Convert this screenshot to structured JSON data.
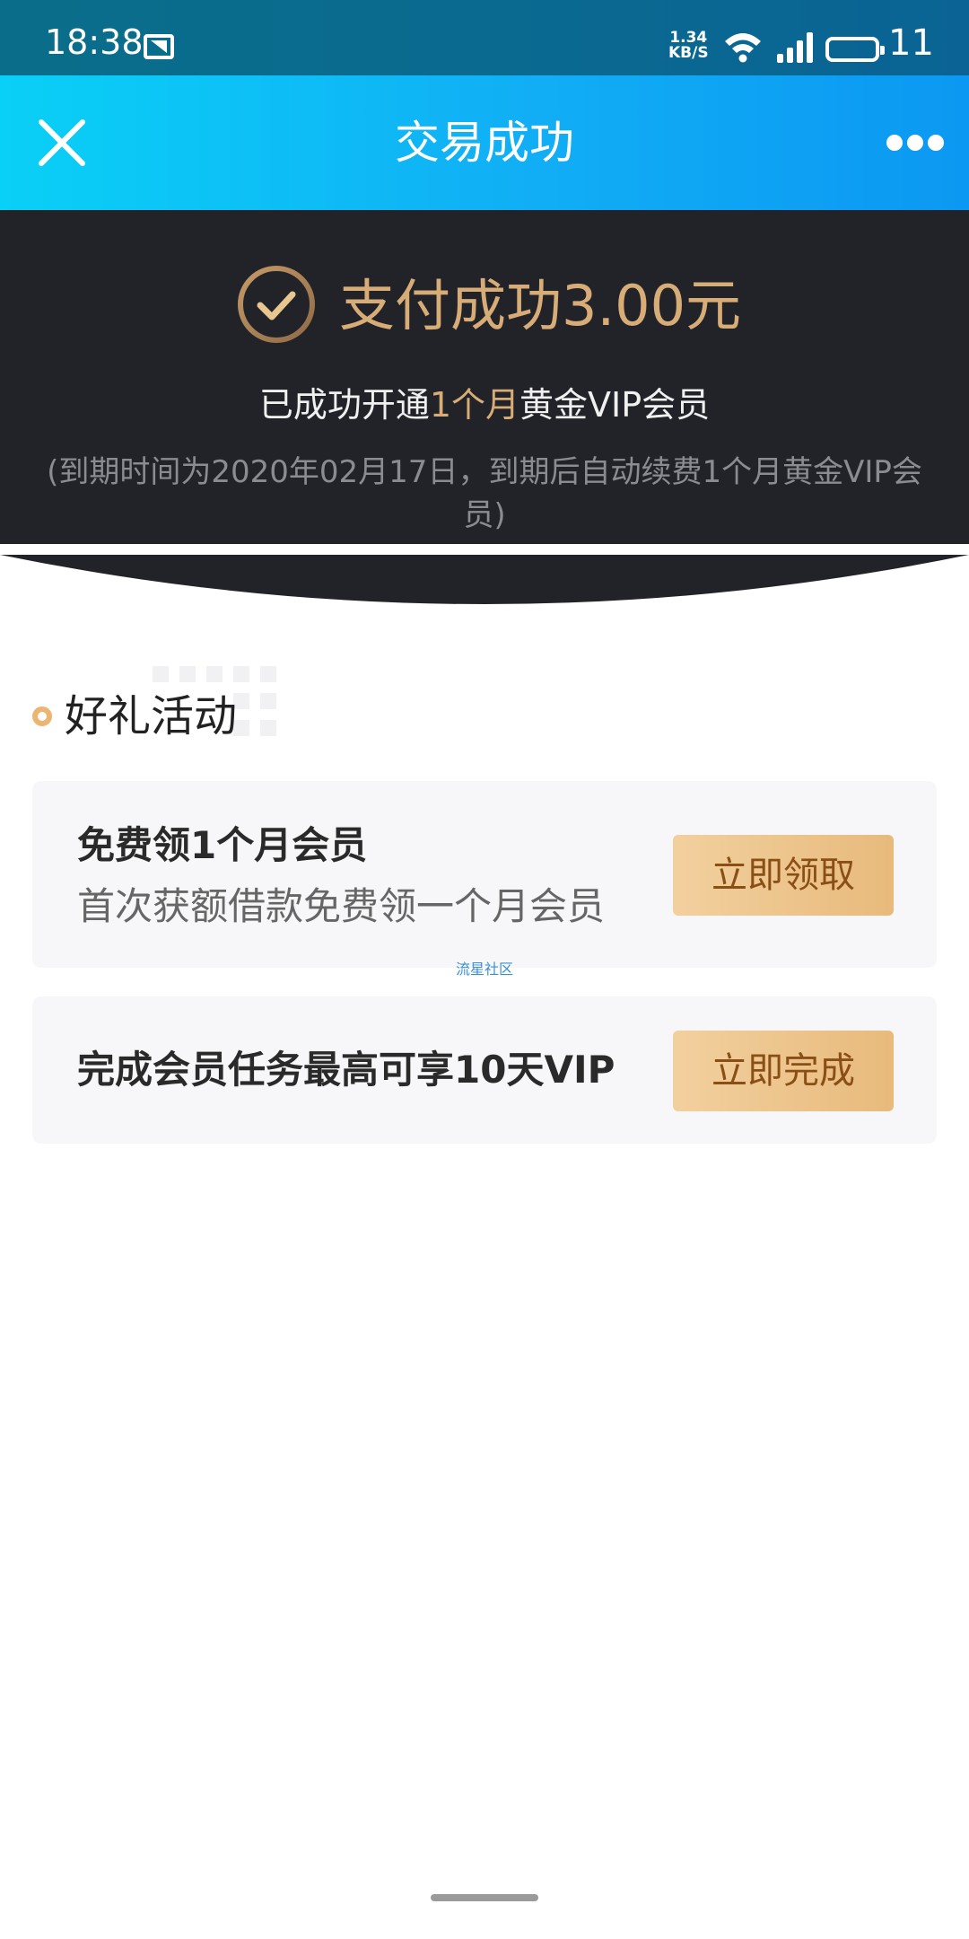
{
  "status_bar": {
    "time": "18:38",
    "net_speed_value": "1.34",
    "net_speed_unit": "KB/S",
    "battery_level": "11",
    "icons": [
      "notification-icon",
      "wifi-icon",
      "signal-icon",
      "battery-icon"
    ]
  },
  "nav": {
    "title": "交易成功",
    "close_icon": "close-icon",
    "more_icon": "more-icon"
  },
  "hero": {
    "pay_amount": "支付成功3.00元",
    "opened_prefix": "已成功开通",
    "opened_highlight": "1个月",
    "opened_suffix": "黄金VIP会员",
    "expire_note": "(到期时间为2020年02月17日，到期后自动续费1个月黄金VIP会员)",
    "accent_color": "#d7ac76"
  },
  "section": {
    "title": "好礼活动"
  },
  "cards": [
    {
      "title": "免费领1个月会员",
      "subtitle": "首次获额借款免费领一个月会员",
      "button": "立即领取"
    },
    {
      "title": "完成会员任务最高可享10天VIP",
      "button": "立即完成"
    }
  ],
  "watermark": "流星社区"
}
